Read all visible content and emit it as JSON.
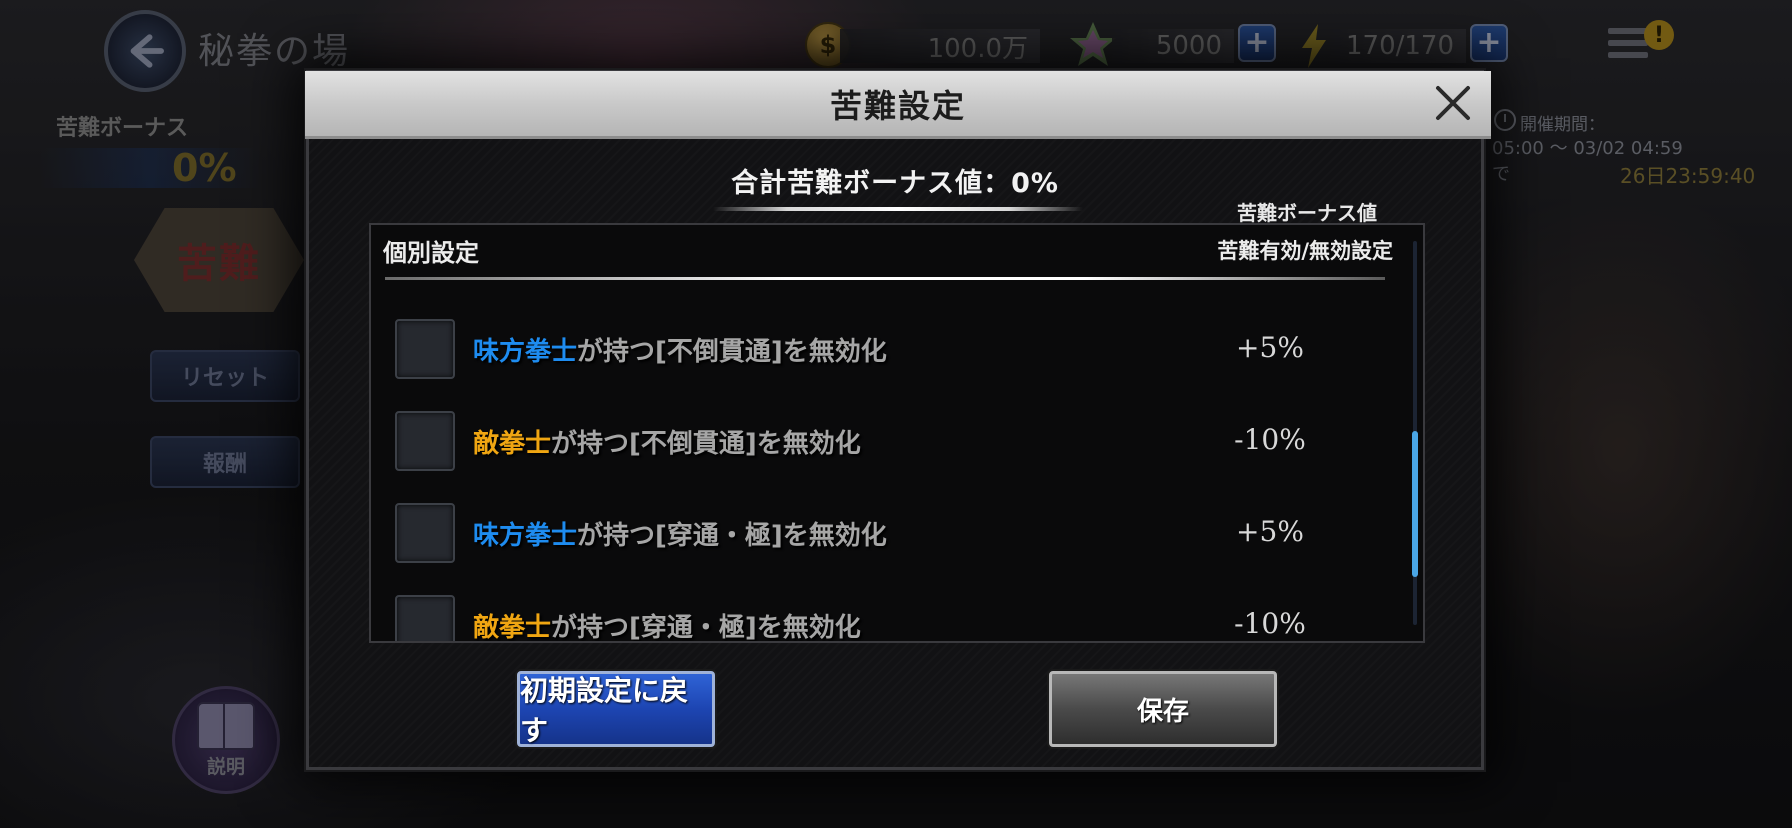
{
  "background": {
    "screen_title": "秘拳の場",
    "bonus_label": "苦難ボーナス",
    "bonus_value": "0%",
    "difficulty_badge": "苦難",
    "reset_label": "リセット",
    "reward_label": "報酬",
    "help_label": "説明",
    "currency": {
      "coins": "100.0万",
      "gems": "5000",
      "stamina": "170/170"
    },
    "event": {
      "period_label": "開催期間：",
      "period_range": "05:00 ～ 03/02 04:59",
      "remaining_prefix": "で",
      "remaining": "26日23:59:40"
    }
  },
  "modal": {
    "title": "苦難設定",
    "total_bonus": "合計苦難ボーナス値：0%",
    "bonus_column_header": "苦難ボーナス値",
    "section_title": "個別設定",
    "toggle_column_header": "苦難有効/無効設定",
    "rows": [
      {
        "subject": "味方拳士",
        "subject_type": "ally",
        "rest": "が持つ[不倒貫通]を無効化",
        "value": "+5%",
        "checked": false
      },
      {
        "subject": "敵拳士",
        "subject_type": "enemy",
        "rest": "が持つ[不倒貫通]を無効化",
        "value": "-10%",
        "checked": false
      },
      {
        "subject": "味方拳士",
        "subject_type": "ally",
        "rest": "が持つ[穿通・極]を無効化",
        "value": "+5%",
        "checked": false
      },
      {
        "subject": "敵拳士",
        "subject_type": "enemy",
        "rest": "が持つ[穿通・極]を無効化",
        "value": "-10%",
        "checked": false
      }
    ],
    "reset_button": "初期設定に戻す",
    "save_button": "保存"
  },
  "colors": {
    "ally": "#1e8cf0",
    "enemy": "#f0a612",
    "primary_button": "#1d45b2",
    "scroll_thumb": "#4aa6e6"
  },
  "icons": [
    "back-arrow-icon",
    "coin-icon",
    "gem-icon",
    "lightning-icon",
    "plus-icon",
    "menu-icon",
    "notice-icon",
    "clock-icon",
    "book-icon",
    "close-icon"
  ]
}
